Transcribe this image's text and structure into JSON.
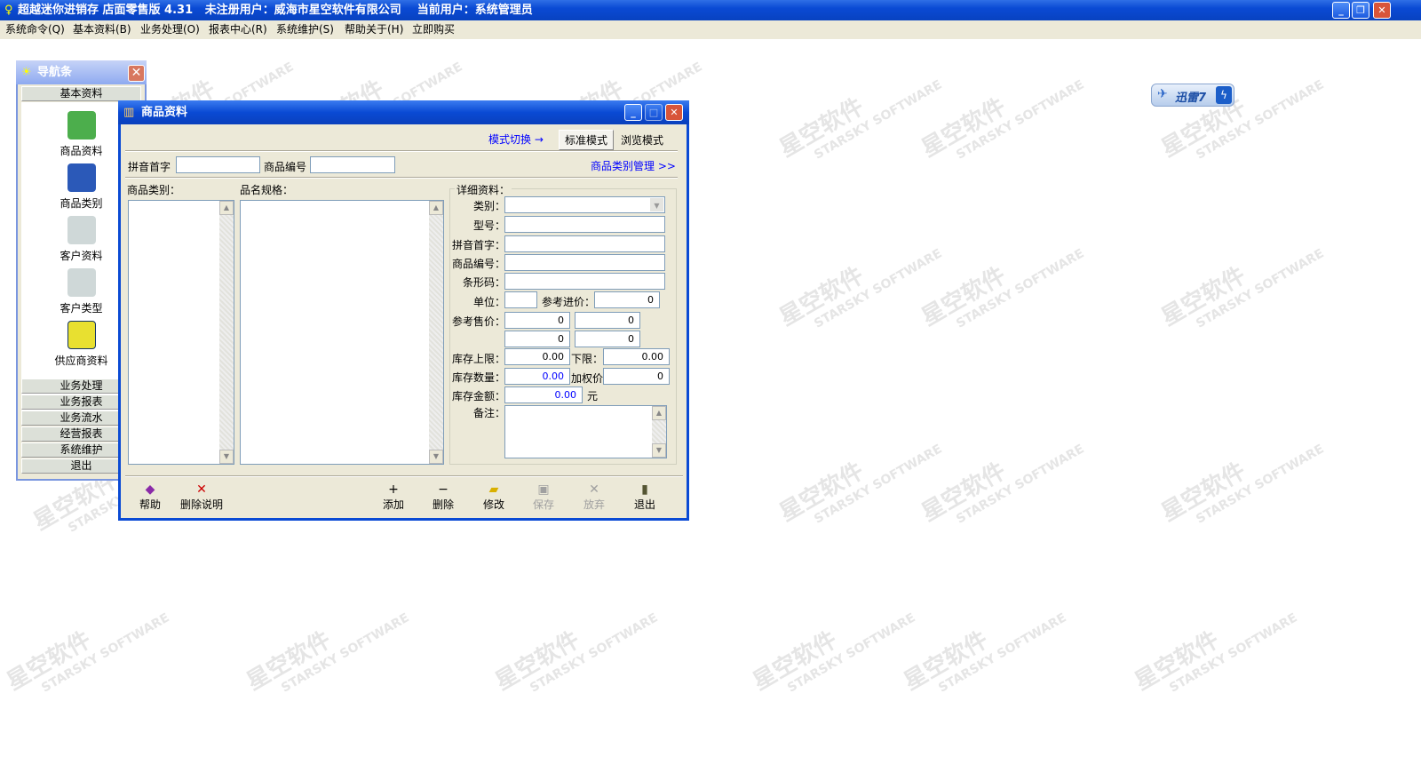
{
  "app": {
    "title": "超越迷你进销存 店面零售版 4.31   未注册用户：威海市星空软件有限公司    当前用户：系统管理员"
  },
  "menu": [
    "系统命令(Q)",
    "基本资料(B)",
    "业务处理(O)",
    "报表中心(R)",
    "系统维护(S)",
    "帮助关于(H)",
    "立即购买"
  ],
  "watermark": {
    "cn": "星空软件",
    "en": "STARSKY SOFTWARE"
  },
  "xunlei": {
    "label": "迅雷7"
  },
  "nav": {
    "title": "导航条",
    "section_basic": "基本资料",
    "items": [
      "商品资料",
      "商品类别",
      "客户资料",
      "客户类型",
      "供应商资料"
    ],
    "sections": [
      "业务处理",
      "业务报表",
      "业务流水",
      "经营报表",
      "系统维护",
      "退出"
    ]
  },
  "window": {
    "title": "商品资料",
    "mode_switch": "模式切换 →",
    "mode_standard": "标准模式",
    "mode_browse": "浏览模式",
    "pinyin_label": "拼音首字",
    "code_label": "商品编号",
    "category_mgmt": "商品类别管理 >>",
    "category_list_label": "商品类别：",
    "product_list_label": "品名规格：",
    "detail": {
      "group": "详细资料：",
      "category": "类别：",
      "model": "型号：",
      "pinyin": "拼音首字：",
      "code": "商品编号：",
      "barcode": "条形码：",
      "unit": "单位：",
      "ref_cost": "参考进价：",
      "ref_cost_value": "0",
      "ref_price": "参考售价：",
      "prices": [
        "0",
        "0",
        "0",
        "0"
      ],
      "stock_max": "库存上限：",
      "stock_max_value": "0.00",
      "stock_min": "下限：",
      "stock_min_value": "0.00",
      "stock_qty": "库存数量：",
      "stock_qty_value": "0.00",
      "weighted": "加权价",
      "weighted_value": "0",
      "stock_amount": "库存金额：",
      "stock_amount_value": "0.00",
      "currency": "元",
      "remark": "备注："
    },
    "toolbar": {
      "help": "帮助",
      "delete_note": "删除说明",
      "add": "添加",
      "delete": "删除",
      "edit": "修改",
      "save": "保存",
      "discard": "放弃",
      "exit": "退出"
    }
  }
}
